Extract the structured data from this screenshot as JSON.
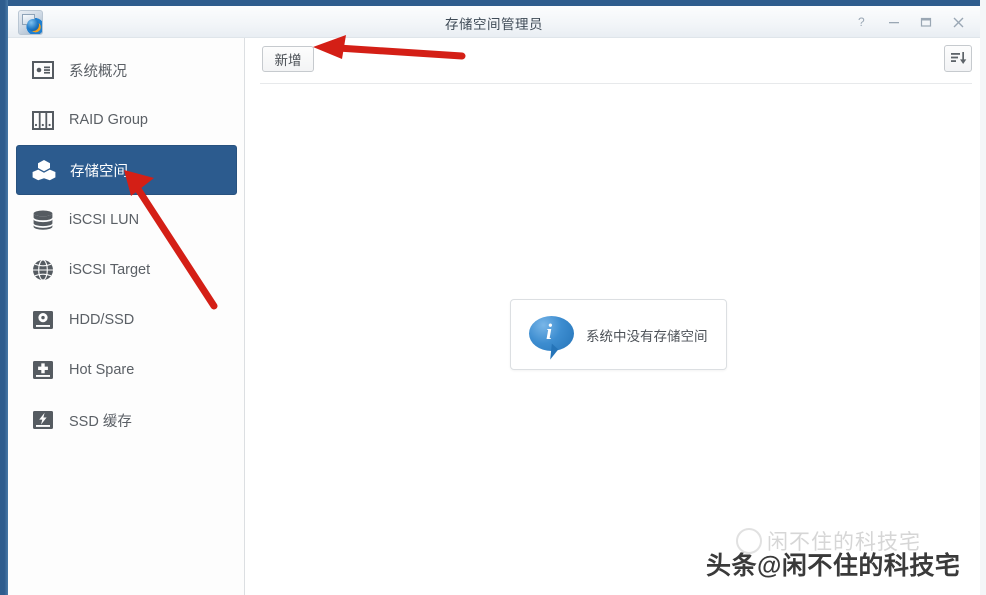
{
  "window": {
    "title": "存储空间管理员",
    "app_icon": "storage-manager-icon",
    "controls": {
      "help": "?",
      "minimize": "−",
      "maximize": "□",
      "close": "✕"
    }
  },
  "sidebar": {
    "items": [
      {
        "label": "系统概况",
        "icon": "overview-card-icon",
        "selected": false
      },
      {
        "label": "RAID Group",
        "icon": "raid-group-icon",
        "selected": false
      },
      {
        "label": "存储空间",
        "icon": "storage-volume-icon",
        "selected": true
      },
      {
        "label": "iSCSI LUN",
        "icon": "database-disk-icon",
        "selected": false
      },
      {
        "label": "iSCSI Target",
        "icon": "globe-icon",
        "selected": false
      },
      {
        "label": "HDD/SSD",
        "icon": "hard-disk-icon",
        "selected": false
      },
      {
        "label": "Hot Spare",
        "icon": "hot-spare-plus-icon",
        "selected": false
      },
      {
        "label": "SSD 缓存",
        "icon": "ssd-cache-bolt-icon",
        "selected": false
      }
    ]
  },
  "toolbar": {
    "add_label": "新增",
    "sort_icon": "sort-descending-icon"
  },
  "main": {
    "empty_message": "系统中没有存储空间",
    "empty_icon": "info-bubble-icon"
  },
  "annotations": {
    "arrow_to_add_button": "red-arrow-left",
    "arrow_to_storage_nav": "red-arrow-up-left",
    "arrow_color": "#d41f16"
  },
  "watermark": {
    "faint": "闲不住的科技宅",
    "main": "头条@闲不住的科技宅"
  },
  "colors": {
    "window_border": "#2f5d8e",
    "selected_nav": "#2c5b8e",
    "info_blue": "#2574b8",
    "annotation_red": "#d41f16"
  }
}
